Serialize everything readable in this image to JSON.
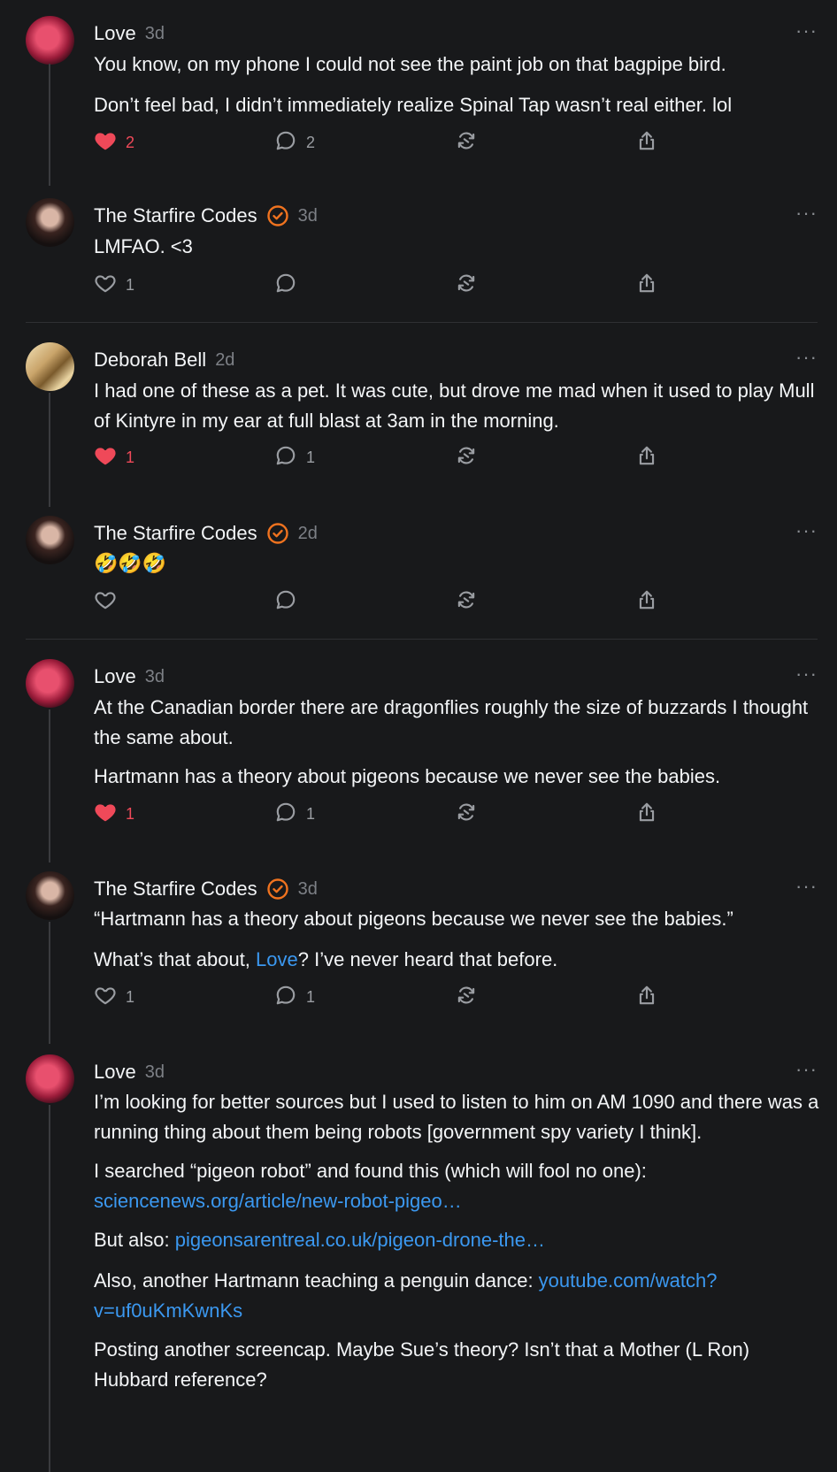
{
  "posts": [
    {
      "author": "Love",
      "time": "3d",
      "verified": false,
      "paragraphs": [
        [
          {
            "t": "You know, on my phone I could not see the paint job on that bagpipe bird."
          }
        ],
        [
          {
            "t": "Don’t feel bad, I didn’t immediately realize Spinal Tap wasn’t real either. lol"
          }
        ]
      ],
      "likes": "2",
      "liked": true,
      "replies": "2"
    },
    {
      "author": "The Starfire Codes",
      "time": "3d",
      "verified": true,
      "paragraphs": [
        [
          {
            "t": "LMFAO. <3"
          }
        ]
      ],
      "likes": "1",
      "liked": false,
      "replies": ""
    },
    {
      "author": "Deborah Bell",
      "time": "2d",
      "verified": false,
      "paragraphs": [
        [
          {
            "t": "I had one of these as a pet. It was cute, but drove me mad when it used to play Mull of Kintyre in my ear at full blast at 3am in the morning."
          }
        ]
      ],
      "likes": "1",
      "liked": true,
      "replies": "1"
    },
    {
      "author": "The Starfire Codes",
      "time": "2d",
      "verified": true,
      "paragraphs": [
        [
          {
            "t": "🤣🤣🤣"
          }
        ]
      ],
      "likes": "",
      "liked": false,
      "replies": ""
    },
    {
      "author": "Love",
      "time": "3d",
      "verified": false,
      "paragraphs": [
        [
          {
            "t": "At the Canadian border there are dragonflies roughly the size of buzzards I thought the same about."
          }
        ],
        [
          {
            "t": "Hartmann has a theory about pigeons because we never see the babies."
          }
        ]
      ],
      "likes": "1",
      "liked": true,
      "replies": "1"
    },
    {
      "author": "The Starfire Codes",
      "time": "3d",
      "verified": true,
      "paragraphs": [
        [
          {
            "t": "“Hartmann has a theory about pigeons because we never see the babies.”"
          }
        ],
        [
          {
            "t": "What’s that about, "
          },
          {
            "t": "Love",
            "link": true
          },
          {
            "t": "? I’ve never heard that before."
          }
        ]
      ],
      "likes": "1",
      "liked": false,
      "replies": "1"
    },
    {
      "author": "Love",
      "time": "3d",
      "verified": false,
      "paragraphs": [
        [
          {
            "t": "I’m looking for better sources but I used to listen to him on AM 1090 and there was a running thing about them being robots [government spy variety I think]."
          }
        ],
        [
          {
            "t": "I searched “pigeon robot” and found this (which will fool no one): "
          },
          {
            "t": "sciencenews.org/article/new-robot-pigeo…",
            "link": true
          }
        ],
        [
          {
            "t": "But also: "
          },
          {
            "t": "pigeonsarentreal.co.uk/pigeon-drone-the…",
            "link": true
          }
        ],
        [
          {
            "t": "Also, another Hartmann teaching a penguin dance: "
          },
          {
            "t": "youtube.com/watch?v=uf0uKmKwnKs",
            "link": true
          }
        ],
        [
          {
            "t": "Posting another screencap. Maybe Sue’s theory? Isn’t that a Mother (L Ron) Hubbard reference?"
          }
        ]
      ],
      "likes": "",
      "liked": false,
      "replies": ""
    }
  ],
  "icons": {
    "like": "heart-icon",
    "reply": "comment-icon",
    "repost": "repost-icon",
    "share": "share-icon",
    "more": "more-icon",
    "verified": "verified-badge-icon"
  },
  "colors": {
    "background": "#18191b",
    "text": "#f3f5f7",
    "muted": "#7d8086",
    "like_active": "#ef4959",
    "link": "#3b98f0",
    "verified": "#f0731f"
  },
  "more_label": "···"
}
